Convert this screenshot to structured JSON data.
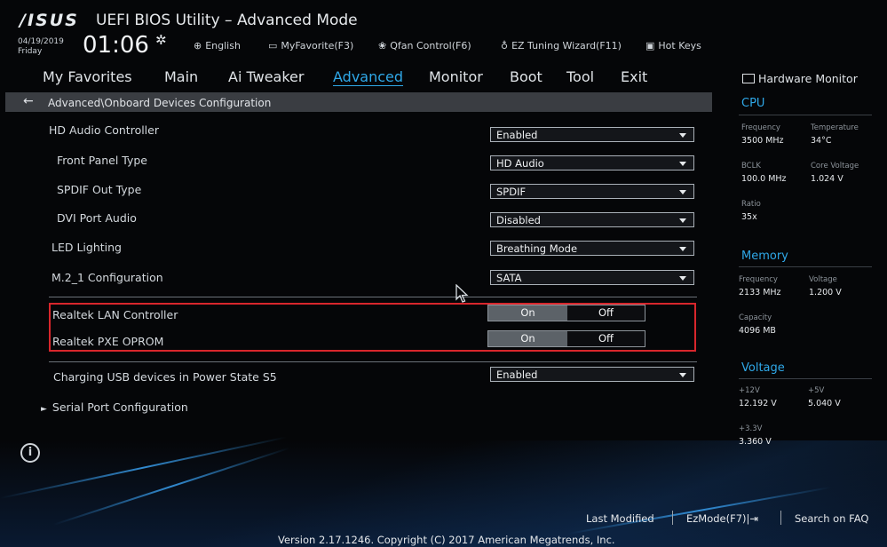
{
  "header": {
    "logo": "/ISUS",
    "title": "UEFI BIOS Utility – Advanced Mode",
    "date": "04/19/2019",
    "day": "Friday",
    "time": "01:06",
    "buttons": [
      {
        "icon": "globe-icon",
        "label": "English"
      },
      {
        "icon": "star-folder-icon",
        "label": "MyFavorite(F3)"
      },
      {
        "icon": "fan-icon",
        "label": "Qfan Control(F6)"
      },
      {
        "icon": "bulb-icon",
        "label": "EZ Tuning Wizard(F11)"
      },
      {
        "icon": "question-box-icon",
        "label": "Hot Keys"
      }
    ]
  },
  "tabs": [
    {
      "label": "My Favorites"
    },
    {
      "label": "Main"
    },
    {
      "label": "Ai Tweaker"
    },
    {
      "label": "Advanced",
      "active": true
    },
    {
      "label": "Monitor"
    },
    {
      "label": "Boot"
    },
    {
      "label": "Tool"
    },
    {
      "label": "Exit"
    }
  ],
  "breadcrumb": "Advanced\\Onboard Devices Configuration",
  "settings": {
    "hd_audio": {
      "label": "HD Audio Controller",
      "value": "Enabled"
    },
    "front_panel": {
      "label": "Front Panel Type",
      "value": "HD Audio"
    },
    "spdif": {
      "label": "SPDIF Out Type",
      "value": "SPDIF"
    },
    "dvi_audio": {
      "label": "DVI Port Audio",
      "value": "Disabled"
    },
    "led": {
      "label": "LED Lighting",
      "value": "Breathing Mode"
    },
    "m2": {
      "label": "M.2_1 Configuration",
      "value": "SATA"
    },
    "lan": {
      "label": "Realtek LAN Controller",
      "on": "On",
      "off": "Off"
    },
    "pxe": {
      "label": "Realtek PXE OPROM",
      "on": "On",
      "off": "Off"
    },
    "usb_s5": {
      "label": "Charging USB devices in Power State S5",
      "value": "Enabled"
    },
    "serial": {
      "label": "Serial Port Configuration"
    }
  },
  "hardware_monitor": {
    "title": "Hardware Monitor",
    "cpu": {
      "heading": "CPU",
      "frequency_label": "Frequency",
      "frequency": "3500 MHz",
      "temperature_label": "Temperature",
      "temperature": "34°C",
      "bclk_label": "BCLK",
      "bclk": "100.0 MHz",
      "core_voltage_label": "Core Voltage",
      "core_voltage": "1.024 V",
      "ratio_label": "Ratio",
      "ratio": "35x"
    },
    "memory": {
      "heading": "Memory",
      "frequency_label": "Frequency",
      "frequency": "2133 MHz",
      "voltage_label": "Voltage",
      "voltage": "1.200 V",
      "capacity_label": "Capacity",
      "capacity": "4096 MB"
    },
    "voltage": {
      "heading": "Voltage",
      "v12_label": "+12V",
      "v12": "12.192 V",
      "v5_label": "+5V",
      "v5": "5.040 V",
      "v33_label": "+3.3V",
      "v33": "3.360 V"
    }
  },
  "footer": {
    "last_modified": "Last Modified",
    "ezmode": "EzMode(F7)|⇥",
    "search": "Search on FAQ",
    "version": "Version 2.17.1246. Copyright (C) 2017 American Megatrends, Inc."
  },
  "colors": {
    "accent": "#2fa8e8",
    "highlight_border": "#d8262c",
    "background": "#050608"
  }
}
